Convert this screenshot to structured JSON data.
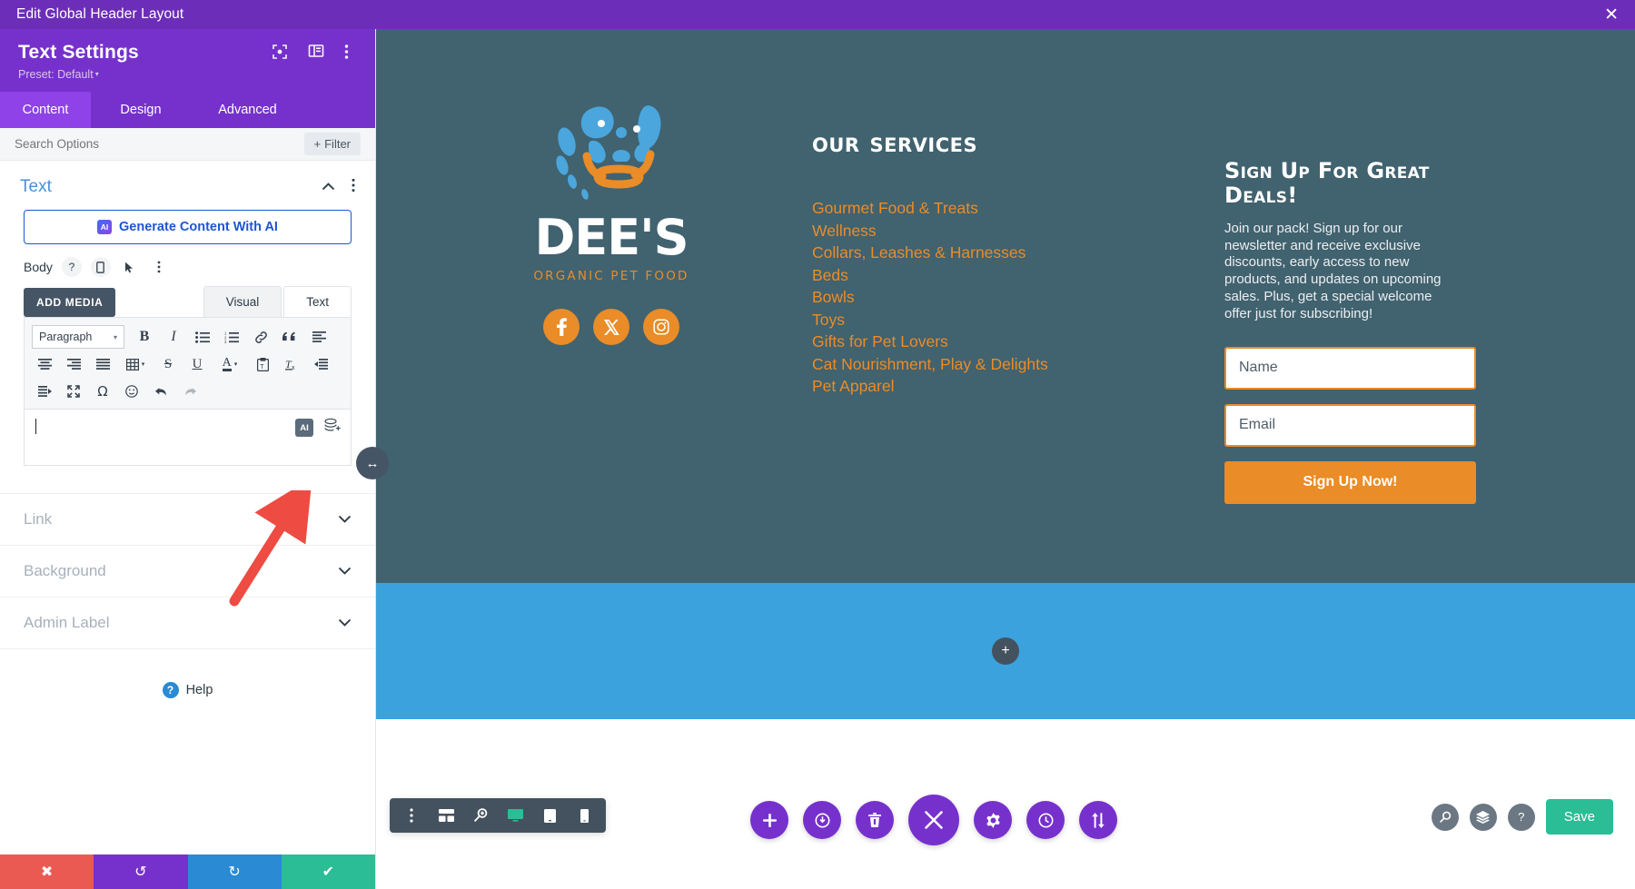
{
  "topbar": {
    "title": "Edit Global Header Layout",
    "close_icon": "close-icon"
  },
  "panel": {
    "title": "Text Settings",
    "preset": "Preset: Default",
    "preset_caret": "▾",
    "head_icons": [
      "focus-icon",
      "layout-columns-icon",
      "more-vertical-icon"
    ],
    "tabs": [
      {
        "label": "Content",
        "active": true
      },
      {
        "label": "Design",
        "active": false
      },
      {
        "label": "Advanced",
        "active": false
      }
    ],
    "search": {
      "placeholder": "Search Options",
      "value": ""
    },
    "filter_button": {
      "plus": "+",
      "label": "Filter"
    },
    "section": {
      "title": "Text",
      "collapse_icon": "chevron-up-icon",
      "more_icon": "more-vertical-icon"
    },
    "ai_generate": {
      "badge": "AI",
      "label": "Generate Content With AI"
    },
    "body_row": {
      "label": "Body",
      "icons": [
        "help-icon",
        "mobile-icon",
        "cursor-icon",
        "more-vertical-icon"
      ],
      "help_glyph": "?"
    },
    "editor": {
      "add_media": "ADD MEDIA",
      "tabs": [
        {
          "label": "Visual",
          "active": true
        },
        {
          "label": "Text",
          "active": false
        }
      ],
      "format_select": {
        "value": "Paragraph",
        "caret": "▾"
      },
      "toolbar_row1": [
        "bold-icon",
        "italic-icon",
        "bulleted-list-icon",
        "numbered-list-icon",
        "link-icon"
      ],
      "toolbar_row2": [
        "blockquote-icon",
        "align-left-icon",
        "align-center-icon",
        "align-right-icon",
        "align-justify-icon",
        "table-icon",
        "strikethrough-icon",
        "underline-icon"
      ],
      "toolbar_row3": [
        "text-color-icon",
        "paste-as-text-icon",
        "clear-formatting-icon",
        "outdent-icon",
        "indent-icon",
        "fullscreen-icon",
        "special-character-icon",
        "emoji-icon",
        "undo-icon"
      ],
      "toolbar_row4": [
        "redo-icon"
      ],
      "content": "",
      "content_icons": [
        "ai-icon",
        "add-layer-icon"
      ],
      "ai_label": "AI"
    },
    "accordion": [
      {
        "label": "Link",
        "chevron": "chevron-down-icon"
      },
      {
        "label": "Background",
        "chevron": "chevron-down-icon"
      },
      {
        "label": "Admin Label",
        "chevron": "chevron-down-icon"
      }
    ],
    "help": {
      "glyph": "?",
      "label": "Help"
    },
    "actions": [
      {
        "name": "cancel",
        "icon": "✖",
        "color": "#ea5a52"
      },
      {
        "name": "undo",
        "icon": "↺",
        "color": "#7631cd"
      },
      {
        "name": "redo",
        "icon": "↻",
        "color": "#2a8ad4"
      },
      {
        "name": "save",
        "icon": "✔",
        "color": "#2bbd96"
      }
    ]
  },
  "drag_handle": {
    "icon": "resize-horizontal-icon",
    "glyph": "↔"
  },
  "canvas": {
    "hero": {
      "background": "#41626f",
      "logo": {
        "wordmark": "DEE'S",
        "tagline": "ORGANIC PET FOOD",
        "mark_colors": {
          "blue": "#4aa6dd",
          "orange": "#ea8c28"
        }
      },
      "socials": [
        {
          "name": "facebook-icon",
          "glyph": "f"
        },
        {
          "name": "x-twitter-icon",
          "glyph": "X"
        },
        {
          "name": "instagram-icon",
          "glyph": "▢"
        }
      ],
      "services": {
        "title": "Our Services",
        "items": [
          "Gourmet Food & Treats",
          "Wellness",
          "Collars, Leashes & Harnesses",
          "Beds",
          "Bowls",
          "Toys",
          "Gifts for Pet Lovers",
          "Cat Nourishment, Play & Delights",
          "Pet Apparel"
        ],
        "item_color": "#ea8c28"
      },
      "signup": {
        "title": "Sign Up For Great Deals!",
        "copy": "Join our pack! Sign up for our newsletter and receive exclusive discounts, early access to new products, and updates on upcoming sales. Plus, get a special welcome offer just for subscribing!",
        "name_placeholder": "Name",
        "name_value": "",
        "email_placeholder": "Email",
        "email_value": "",
        "button_label": "Sign Up Now!",
        "accent": "#ea8c28"
      }
    },
    "band_blue": {
      "color": "#3ba2dd",
      "add_icon": "+"
    },
    "band_white": {
      "color": "#ffffff"
    }
  },
  "bottom_toolbars": {
    "left": {
      "icons": [
        {
          "name": "more-vertical-icon",
          "active": false
        },
        {
          "name": "wireframe-icon",
          "active": false
        },
        {
          "name": "zoom-icon",
          "active": false
        },
        {
          "name": "desktop-icon",
          "active": true
        },
        {
          "name": "tablet-icon",
          "active": false
        },
        {
          "name": "phone-icon",
          "active": false
        }
      ]
    },
    "center": {
      "buttons": [
        {
          "name": "add-icon",
          "glyph": "+",
          "big": false
        },
        {
          "name": "power-icon",
          "glyph": "⏻",
          "big": false
        },
        {
          "name": "trash-icon",
          "glyph": "🗑",
          "big": false
        },
        {
          "name": "close-icon",
          "glyph": "✕",
          "big": true
        },
        {
          "name": "settings-gear-icon",
          "glyph": "⚙",
          "big": false
        },
        {
          "name": "history-clock-icon",
          "glyph": "◴",
          "big": false
        },
        {
          "name": "sort-updown-icon",
          "glyph": "⇅",
          "big": false
        }
      ]
    },
    "right": {
      "icons": [
        {
          "name": "search-zoom-icon",
          "glyph": "⌕"
        },
        {
          "name": "layers-icon",
          "glyph": "≣"
        },
        {
          "name": "help-icon",
          "glyph": "?"
        }
      ],
      "save_label": "Save",
      "save_color": "#2bbd96"
    }
  },
  "annotation": {
    "arrow_color": "#ee4b42",
    "points_to": "add-layer-icon"
  }
}
